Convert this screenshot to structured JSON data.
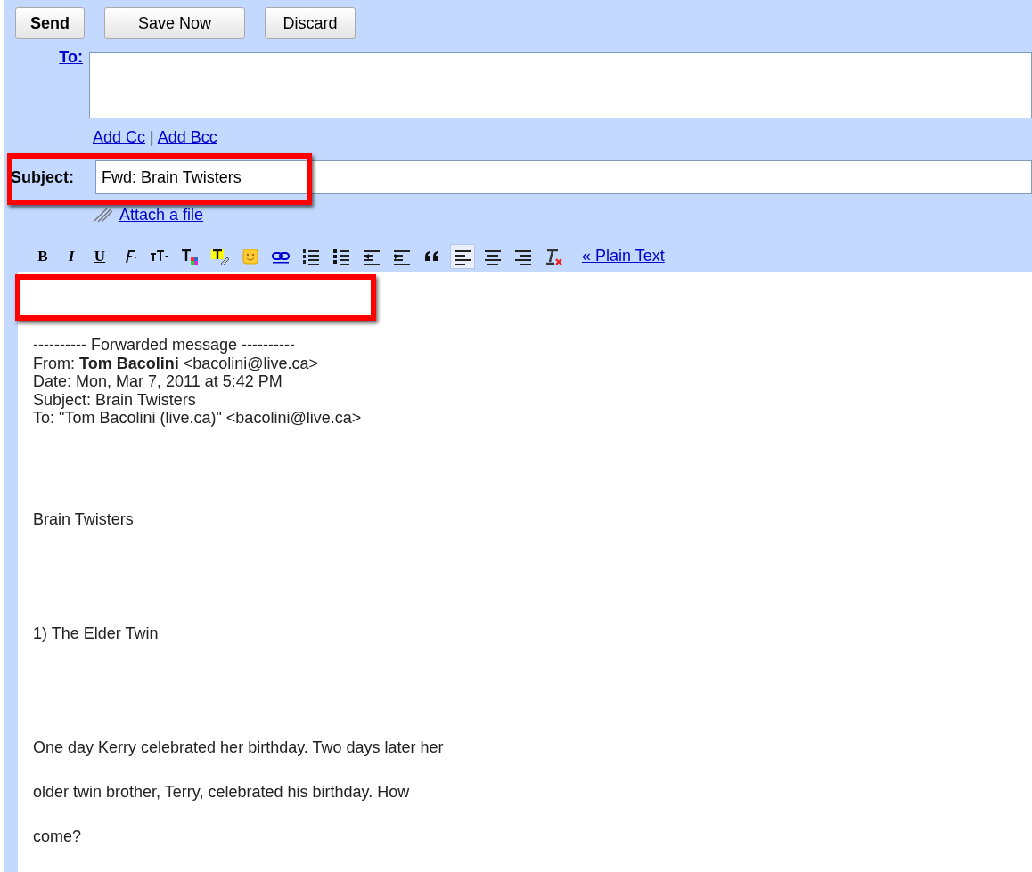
{
  "buttons": [
    {
      "label": "Send",
      "kind": "primary"
    },
    {
      "label": "Save Now",
      "kind": "normal"
    },
    {
      "label": "Discard",
      "kind": "normal"
    }
  ],
  "to": {
    "label": "To:"
  },
  "cc_links": [
    {
      "label": "Add Cc"
    },
    {
      "label": "Add Bcc"
    }
  ],
  "cc_separator": "|",
  "subject": {
    "label": "Subject:",
    "value": "Fwd: Brain Twisters",
    "highlighted": true
  },
  "attach": {
    "label": "Attach a file"
  },
  "toolbar": [
    {
      "kind": "bold",
      "label": "B",
      "selected": false
    },
    {
      "kind": "italic",
      "label": "I",
      "selected": false
    },
    {
      "kind": "underline",
      "label": "U",
      "selected": false
    },
    {
      "kind": "font",
      "selected": false
    },
    {
      "kind": "size",
      "selected": false
    },
    {
      "kind": "text-color",
      "selected": false
    },
    {
      "kind": "highlight",
      "selected": false
    },
    {
      "kind": "smiley",
      "selected": false
    },
    {
      "kind": "link",
      "selected": false
    },
    {
      "kind": "numbered-list",
      "selected": false
    },
    {
      "kind": "bullet-list",
      "selected": false
    },
    {
      "kind": "outdent",
      "selected": false
    },
    {
      "kind": "indent",
      "selected": false
    },
    {
      "kind": "quote",
      "selected": false
    },
    {
      "kind": "align-left",
      "selected": true
    },
    {
      "kind": "align-center",
      "selected": false
    },
    {
      "kind": "align-right",
      "selected": false
    },
    {
      "kind": "remove-format",
      "selected": false
    }
  ],
  "plain_text_link": "« Plain Text",
  "body": {
    "top_highlighted": true,
    "header": [
      "---------- Forwarded message ----------",
      "From: **Tom Bacolini** <bacolini@live.ca>",
      "Date: Mon, Mar 7, 2011 at 5:42 PM",
      "Subject: Brain Twisters",
      "To: \"Tom Bacolini (live.ca)\" <bacolini@live.ca>"
    ],
    "paragraphs": [
      [
        "Brain Twisters"
      ],
      [
        "1) The Elder Twin"
      ],
      [
        "One day Kerry celebrated her birthday. Two days later her",
        "older twin brother, Terry, celebrated his birthday. How",
        "come?"
      ]
    ]
  }
}
